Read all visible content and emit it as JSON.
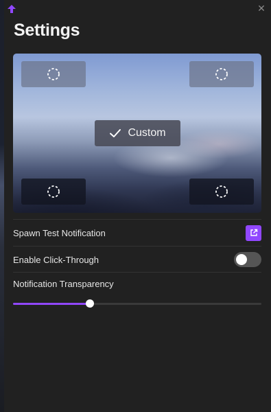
{
  "window": {
    "title": "Settings",
    "app_icon": "twitch-arrow-icon",
    "close_icon": "close-icon",
    "close_glyph": "✕",
    "accent_color": "#9147ff"
  },
  "position_picker": {
    "custom_label": "Custom",
    "corner_icon": "dashed-circle-icon",
    "selected": "custom",
    "corners": [
      "top-left",
      "top-right",
      "bottom-left",
      "bottom-right"
    ]
  },
  "rows": {
    "spawn_test": {
      "label": "Spawn Test Notification",
      "icon": "external-link-icon"
    },
    "click_through": {
      "label": "Enable Click-Through",
      "enabled": false
    },
    "transparency": {
      "label": "Notification Transparency",
      "value": 0.31
    }
  }
}
